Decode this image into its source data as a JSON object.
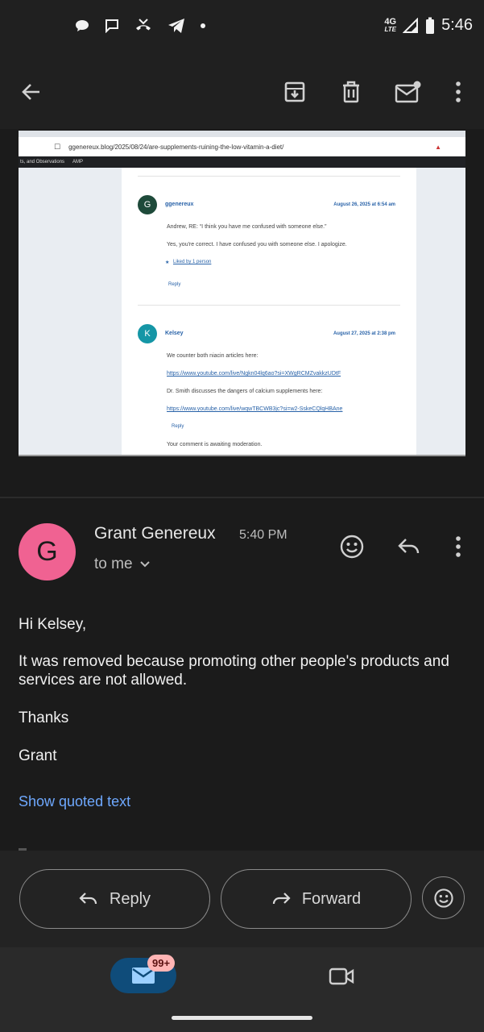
{
  "status_bar": {
    "time": "5:46",
    "network": "4G",
    "network_sub": "LTE",
    "icons": [
      "chat-bubble-icon",
      "message-icon",
      "missed-call-icon",
      "telegram-icon",
      "dot-icon",
      "signal-icon",
      "battery-icon"
    ]
  },
  "app_bar": {
    "icons": [
      "back-arrow-icon",
      "archive-icon",
      "trash-icon",
      "mark-unread-icon",
      "more-vert-icon"
    ]
  },
  "attachment": {
    "url": "ggenereux.blog/2025/08/24/are-supplements-ruining-the-low-vitamin-a-diet/",
    "bookmarks": [
      "ts, and Observations",
      "AMP"
    ],
    "comments": [
      {
        "avatar": "G",
        "author": "ggenereux",
        "date": "August 26, 2025 at 6:54 am",
        "lines": [
          "Andrew, RE: “I think you have me confused with someone else.”",
          "Yes, you're correct. I have confused you with someone else. I apologize."
        ],
        "liked": "Liked by 1 person",
        "reply": "Reply"
      },
      {
        "avatar": "K",
        "author": "Kelsey",
        "date": "August 27, 2025 at 2:38 pm",
        "line1": "We counter both niacin articles here:",
        "link1": "https://www.youtube.com/live/Ngkn04lq6ao?si=XWgRCMZvakkzUDtF",
        "line2": "Dr. Smith discusses the dangers of calcium supplements here:",
        "link2": "https://www.youtube.com/live/wqwTBCWB3jc?si=w2-SskeCQlqHBAne",
        "reply": "Reply",
        "moderation": "Your comment is awaiting moderation."
      }
    ]
  },
  "message": {
    "avatar_letter": "G",
    "sender": "Grant Genereux",
    "time": "5:40 PM",
    "recipient": "to me",
    "greeting": "Hi Kelsey,",
    "body": "It was removed because promoting other people's products and services are not allowed.",
    "closing": "Thanks",
    "signature": "Grant",
    "show_quoted": "Show quoted text"
  },
  "actions": {
    "reply_label": "Reply",
    "forward_label": "Forward"
  },
  "bottom_nav": {
    "badge": "99+"
  },
  "colors": {
    "background": "#1b1b1b",
    "avatar": "#f06292",
    "link": "#6ea8fe",
    "mail_pill": "#0f4c7a",
    "badge": "#ffb4b4"
  }
}
